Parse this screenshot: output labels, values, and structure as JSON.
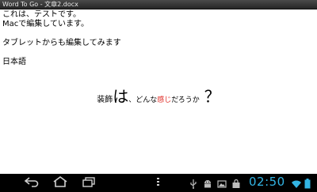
{
  "window": {
    "title": "Word To Go - 文章2.docx"
  },
  "document": {
    "lines": [
      "これは、テストです。",
      "Macで編集しています。",
      "タブレットからも編集してみます",
      "日本語"
    ],
    "decorated": {
      "part1": "装飾",
      "part2": "は",
      "part3": "、どんな",
      "part4": "感じ",
      "part5": "だろうか",
      "part6": "？"
    }
  },
  "status": {
    "time": "02:50"
  },
  "icons": {
    "back": "back-icon",
    "home": "home-icon",
    "recent": "recent-apps-icon",
    "menu": "menu-icon",
    "usb": "usb-icon",
    "android": "android-debug-icon",
    "image": "screenshot-icon",
    "bag": "shopping-bag-icon",
    "wifi": "wifi-icon",
    "battery": "battery-icon"
  },
  "colors": {
    "accent": "#33b5e5",
    "highlight_text": "#e0302a"
  }
}
